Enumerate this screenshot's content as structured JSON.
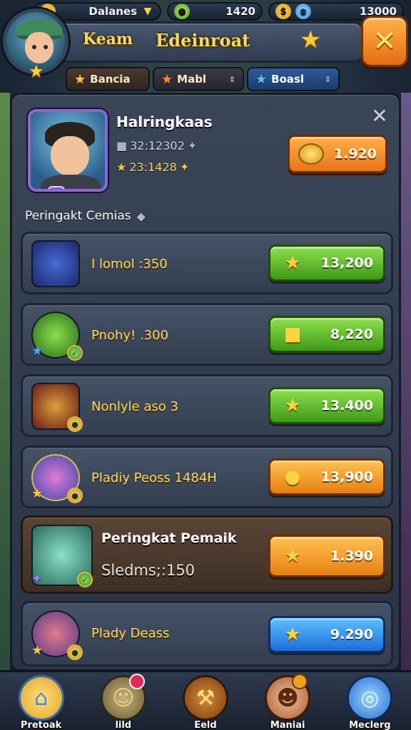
{
  "topbar": {
    "res1_label": "Dalanes",
    "res2_value": "1420",
    "res3_value": "13000"
  },
  "header": {
    "title_left": "Keam",
    "title_right": "Edeinroat"
  },
  "tabs": [
    {
      "label": "Bancia"
    },
    {
      "label": "Mabl"
    },
    {
      "label": "Boasl"
    }
  ],
  "profile": {
    "name": "Halringkaas",
    "stat1": "32:12302",
    "stat2": "23:1428",
    "coin_value": "1.920"
  },
  "section_title": "Peringakt Cemias",
  "rows": [
    {
      "name": "I lomol :350",
      "value": "13,200",
      "button_color": "green",
      "icon": "star-icon"
    },
    {
      "name": "Pnohy! .300",
      "value": "8,220",
      "button_color": "green",
      "icon": "cube-icon"
    },
    {
      "name": "Nonlyle aso 3",
      "value": "13.400",
      "button_color": "green",
      "icon": "star-icon"
    },
    {
      "name": "Pladiy Peoss 1484H",
      "value": "13,900",
      "button_color": "orange",
      "icon": "coin-icon"
    }
  ],
  "highlight_row": {
    "name": "Peringkat Pemaik",
    "sub": "Sledms;:150",
    "value": "1.390",
    "button_color": "orange"
  },
  "last_row": {
    "name": "Plady Deass",
    "value": "9.290",
    "button_color": "blue"
  },
  "bottomnav": [
    {
      "label": "Pretoak"
    },
    {
      "label": "lild"
    },
    {
      "label": "Eeld"
    },
    {
      "label": "Maniai"
    },
    {
      "label": "Meclerg"
    }
  ]
}
